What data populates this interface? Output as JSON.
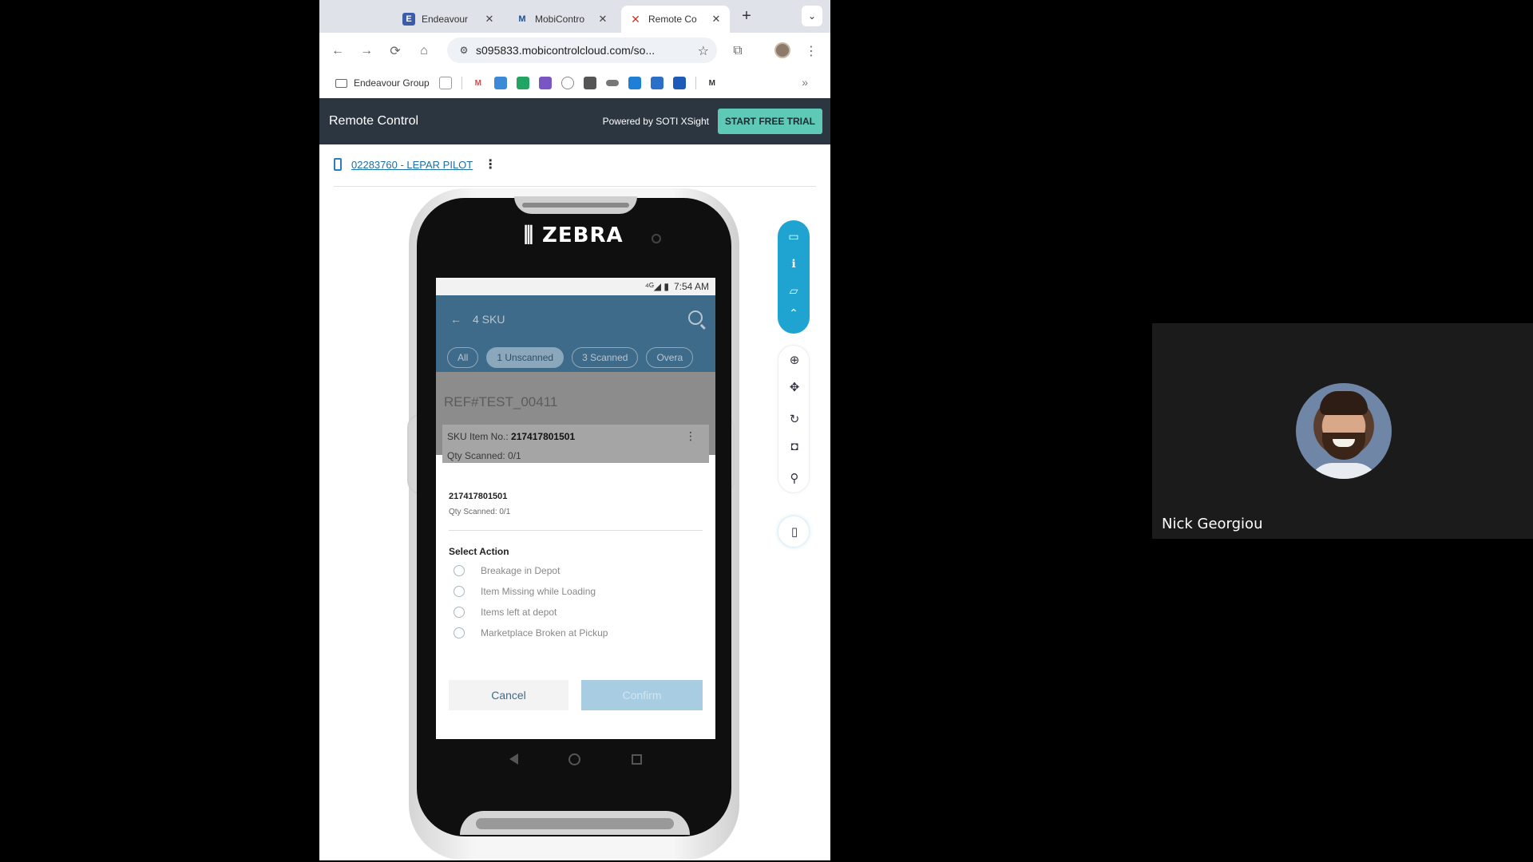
{
  "browser": {
    "tabs": [
      {
        "title": "Endeavour",
        "close": "✕",
        "fav": "E"
      },
      {
        "title": "MobiContro",
        "close": "✕",
        "fav": "M"
      },
      {
        "title": "Remote Co",
        "close": "✕",
        "fav": "✕"
      }
    ],
    "new_tab": "+",
    "url": "s095833.mobicontrolcloud.com/so...",
    "bookmarks": {
      "folder": "Endeavour Group",
      "more": "»"
    }
  },
  "app": {
    "title": "Remote Control",
    "powered_by": "Powered by SOTI XSight",
    "trial_button": "START FREE TRIAL",
    "device_link": "02283760 - LEPAR PILOT",
    "device_menu": "⋮"
  },
  "phone": {
    "brand": "ZEBRA",
    "status_time": "7:54 AM",
    "status_icons": "⁴ᴳ◢ ▮",
    "screen_title": "4 SKU",
    "back_arrow": "←",
    "chips": [
      "All",
      "1 Unscanned",
      "3 Scanned",
      "Overa"
    ],
    "ref": "REF#TEST_00411",
    "sku_label": "SKU Item No.: ",
    "sku_value": "217417801501",
    "qty_line": "Qty Scanned:  0/1",
    "card_menu": "⋮",
    "dialog": {
      "sku": "217417801501",
      "qty": "Qty Scanned: 0/1",
      "heading": "Select Action",
      "options": [
        "Breakage in Depot",
        "Item Missing while Loading",
        "Items left at depot",
        "Marketplace Broken at Pickup"
      ],
      "cancel": "Cancel",
      "confirm": "Confirm"
    }
  },
  "participant": {
    "name": "Nick Georgiou"
  },
  "icons": {
    "back": "←",
    "forward": "→",
    "reload": "⟳",
    "home": "⌂",
    "tune": "⚙",
    "star": "☆",
    "extensions": "⧉",
    "menu": "⋮",
    "chevron": "⌄",
    "cast": "▭",
    "info": "ℹ",
    "folder": "▱",
    "collapse": "⌃",
    "zoom": "⊕",
    "move": "✥",
    "rotate": "↻",
    "camera": "◘",
    "user": "⚲",
    "device": "▯"
  },
  "colors": {
    "accent": "#1fa3d1",
    "header": "#2c3640",
    "trial": "#5ec9b6",
    "app_blue": "#3e6b8a"
  }
}
